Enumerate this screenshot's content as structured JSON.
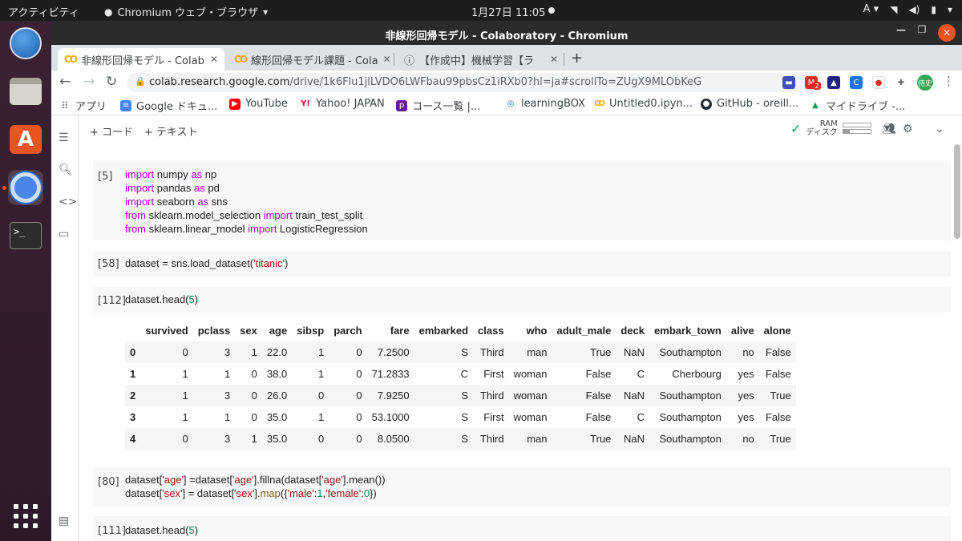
{
  "topbar": {
    "activities": "アクティビティ",
    "app_name": "Chromium ウェブ・ブラウザ",
    "clock": "1月27日  11:05",
    "input_method": "A"
  },
  "window": {
    "title": "非線形回帰モデル - Colaboratory - Chromium"
  },
  "tabs": [
    {
      "label": "非線形回帰モデル - Colab"
    },
    {
      "label": "線形回帰モデル課題 - Cola"
    },
    {
      "label": "【作成中】機械学習【ラ"
    }
  ],
  "address_bar": {
    "host": "colab.research.google.com",
    "path": "/drive/1k6Flu1jlLVDO6LWFbau99pbsCz1iRXb0?hl=ja#scrollTo=ZUgX9MLObKeG"
  },
  "extensions": {
    "badge_count": "2",
    "avatar_text": "侍史"
  },
  "bookmarks": [
    {
      "label": "アプリ"
    },
    {
      "label": "Google ドキュ..."
    },
    {
      "label": "YouTube"
    },
    {
      "label": "Yahoo! JAPAN"
    },
    {
      "label": "コース一覧 |..."
    },
    {
      "label": "learningBOX"
    },
    {
      "label": "Untitled0.ipyn..."
    },
    {
      "label": "GitHub - oreill..."
    },
    {
      "label": "マイドライブ -..."
    }
  ],
  "colab_toolbar": {
    "add_code": "+ コード",
    "add_text": "+ テキスト",
    "ram_label": "RAM",
    "disk_label": "ディスク",
    "ram_level": 0.0,
    "disk_level": 0.25
  },
  "cells": [
    {
      "number": "[5]"
    },
    {
      "number": "[58]"
    },
    {
      "number": "[112]"
    },
    {
      "number": "[80]"
    },
    {
      "number": "[111]"
    }
  ],
  "code": {
    "c5": [
      [
        "import",
        " numpy ",
        "as",
        " np"
      ],
      [
        "import",
        " pandas ",
        "as",
        " pd"
      ],
      [
        "import",
        " seaborn ",
        "as",
        " sns"
      ],
      [
        "from",
        " sklearn.model_selection ",
        "import",
        " train_test_split"
      ],
      [
        "from",
        " sklearn.linear_model ",
        "import",
        " LogisticRegression"
      ]
    ],
    "c58": [
      "dataset = sns.load_dataset(",
      "'titanic'",
      ")"
    ],
    "c112": [
      "dataset.head(",
      "5",
      ")"
    ],
    "c80": [
      [
        "dataset[",
        "'age'",
        "] =dataset[",
        "'age'",
        "].fillna(dataset[",
        "'age'",
        "].mean())"
      ],
      [
        "dataset[",
        "'sex'",
        "] = dataset[",
        "'sex'",
        "].",
        "map",
        "({",
        "'male'",
        ":",
        "1",
        ",",
        "'female'",
        ":",
        "0",
        "})"
      ]
    ],
    "c111": [
      "dataset.head(",
      "5",
      ")"
    ]
  },
  "dataframe": {
    "columns": [
      "",
      "survived",
      "pclass",
      "sex",
      "age",
      "sibsp",
      "parch",
      "fare",
      "embarked",
      "class",
      "who",
      "adult_male",
      "deck",
      "embark_town",
      "alive",
      "alone"
    ],
    "rows": [
      [
        "0",
        "0",
        "3",
        "1",
        "22.0",
        "1",
        "0",
        "7.2500",
        "S",
        "Third",
        "man",
        "True",
        "NaN",
        "Southampton",
        "no",
        "False"
      ],
      [
        "1",
        "1",
        "1",
        "0",
        "38.0",
        "1",
        "0",
        "71.2833",
        "C",
        "First",
        "woman",
        "False",
        "C",
        "Cherbourg",
        "yes",
        "False"
      ],
      [
        "2",
        "1",
        "3",
        "0",
        "26.0",
        "0",
        "0",
        "7.9250",
        "S",
        "Third",
        "woman",
        "False",
        "NaN",
        "Southampton",
        "yes",
        "True"
      ],
      [
        "3",
        "1",
        "1",
        "0",
        "35.0",
        "1",
        "0",
        "53.1000",
        "S",
        "First",
        "woman",
        "False",
        "C",
        "Southampton",
        "yes",
        "False"
      ],
      [
        "4",
        "0",
        "3",
        "1",
        "35.0",
        "0",
        "0",
        "8.0500",
        "S",
        "Third",
        "man",
        "True",
        "NaN",
        "Southampton",
        "no",
        "True"
      ]
    ]
  }
}
